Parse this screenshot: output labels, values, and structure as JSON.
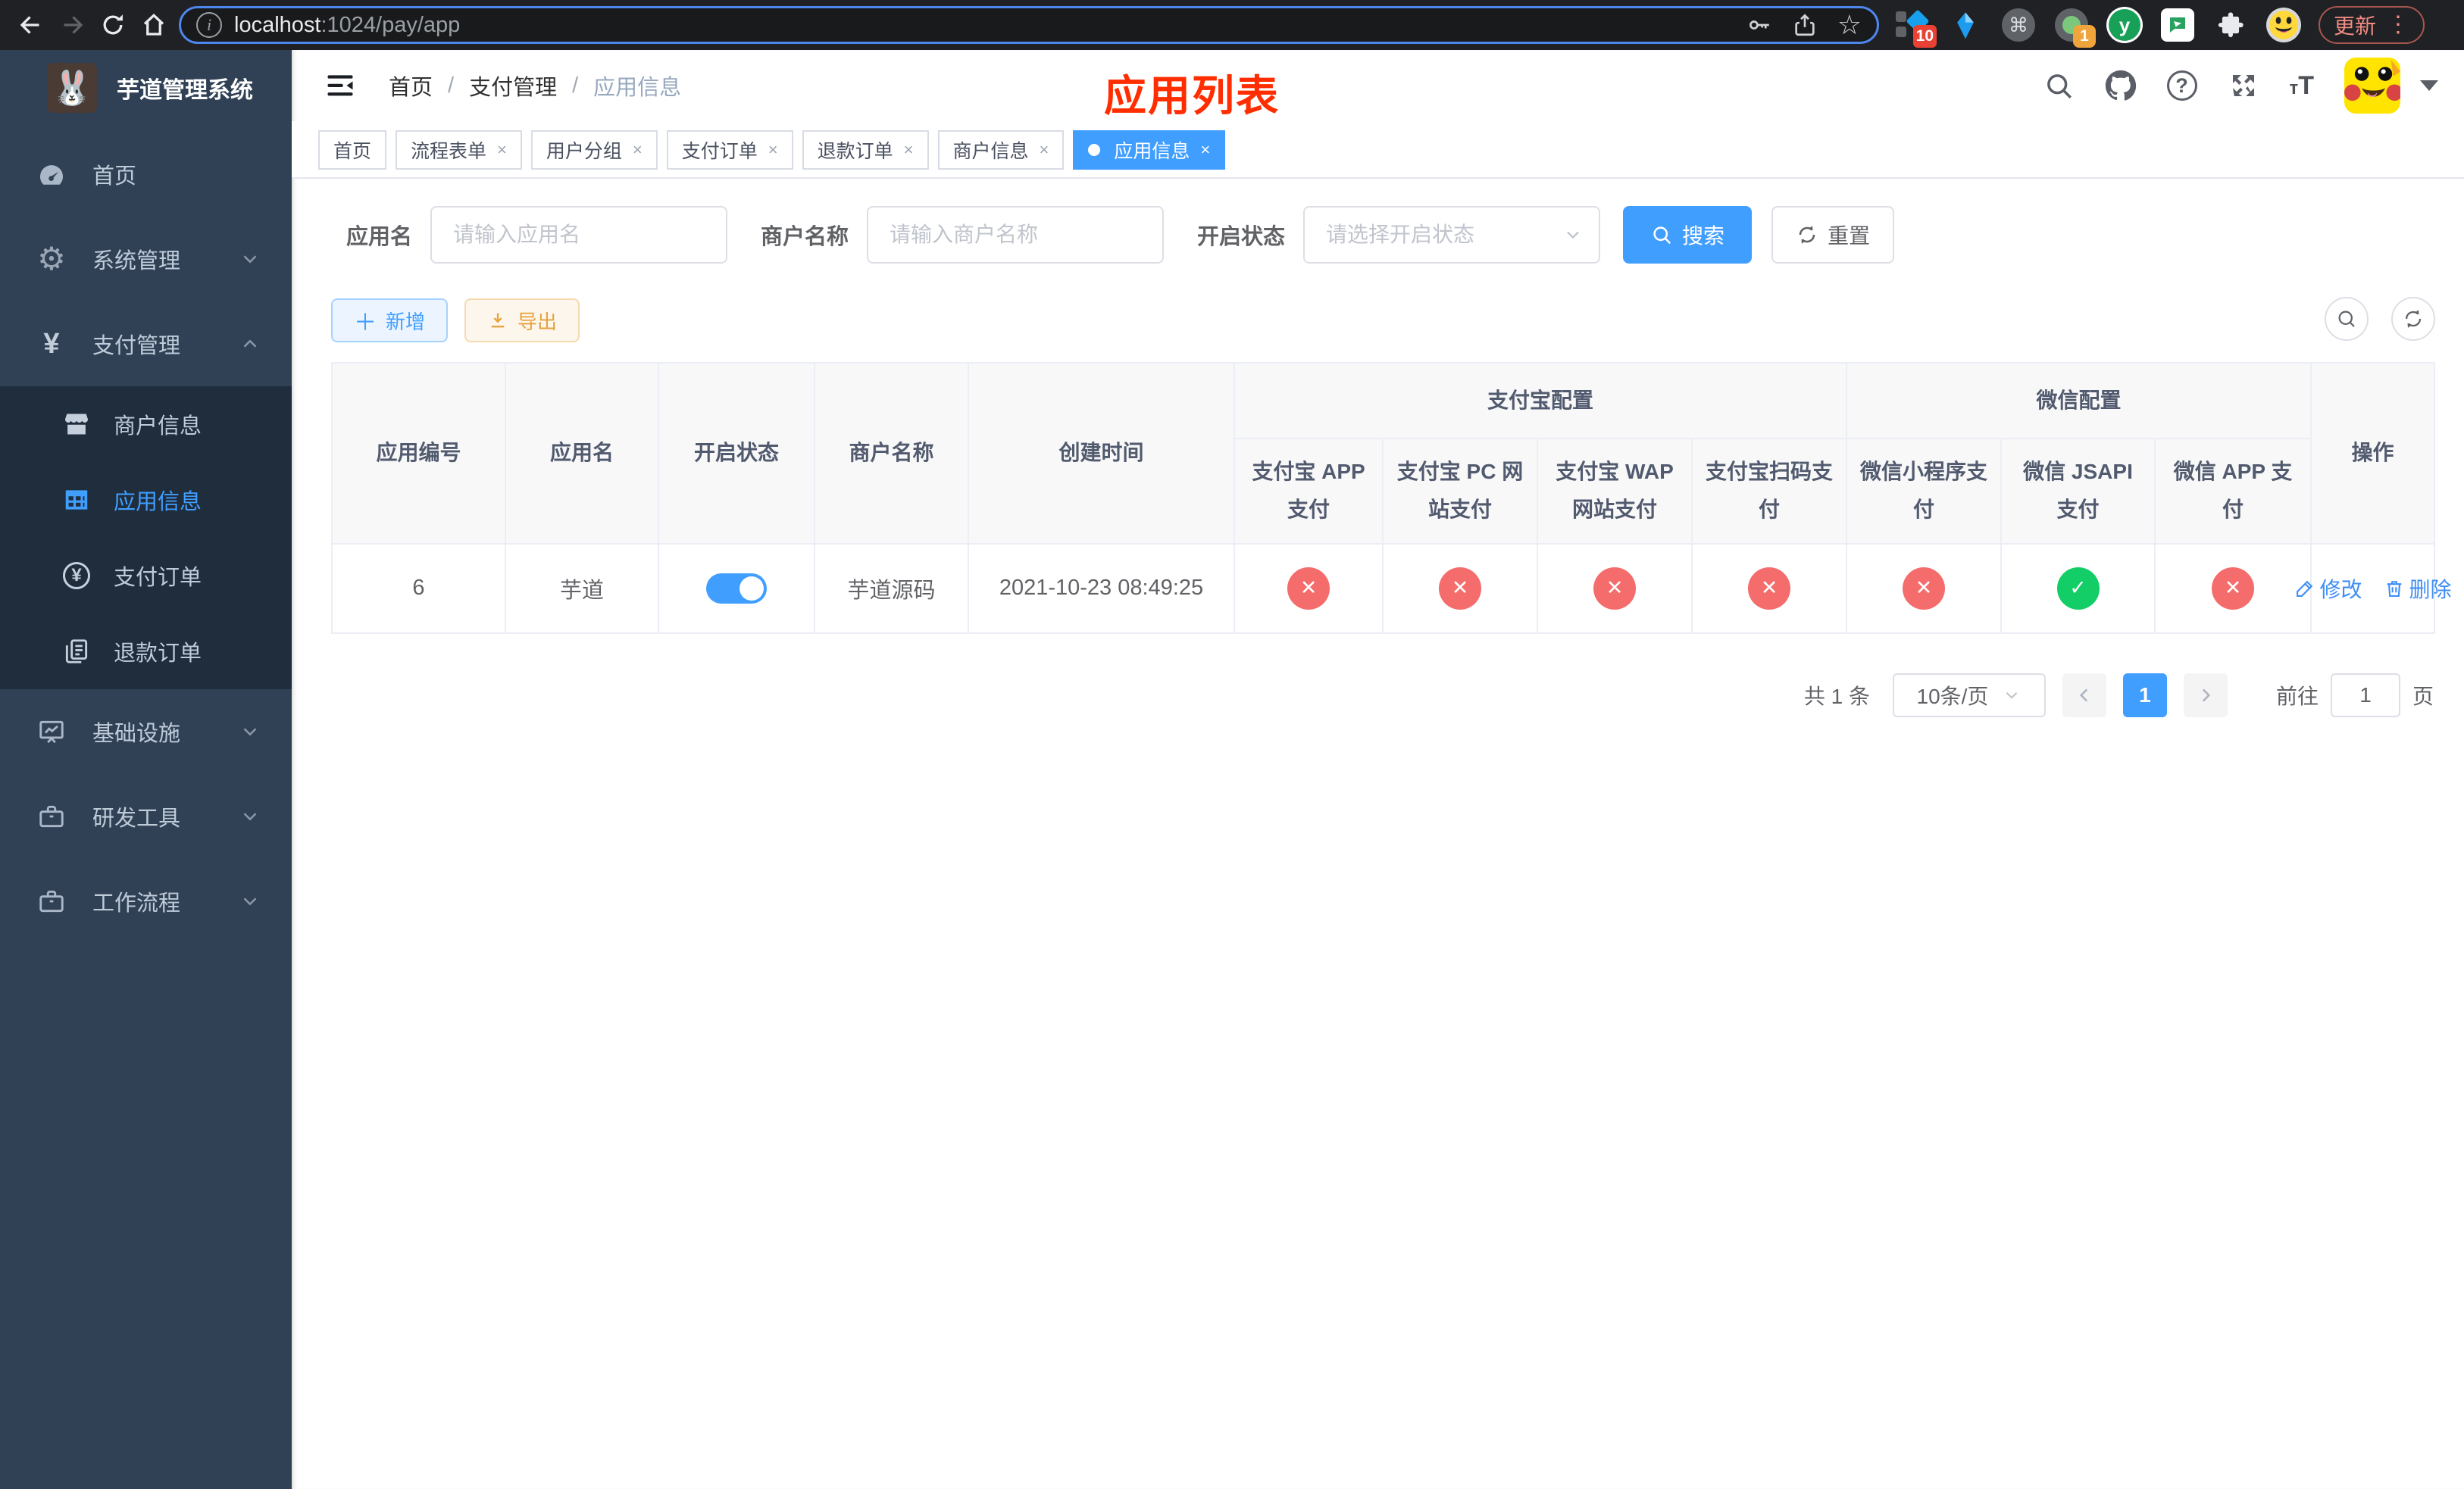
{
  "browser": {
    "url_host": "localhost",
    "url_rest": ":1024/pay/app",
    "update_label": "更新",
    "ext1_badge": "10",
    "ext4_badge": "1"
  },
  "sidebar": {
    "app_title": "芋道管理系统",
    "menu": [
      {
        "label": "首页"
      },
      {
        "label": "系统管理"
      },
      {
        "label": "支付管理"
      },
      {
        "label": "基础设施"
      },
      {
        "label": "研发工具"
      },
      {
        "label": "工作流程"
      }
    ],
    "submenu": [
      {
        "label": "商户信息"
      },
      {
        "label": "应用信息"
      },
      {
        "label": "支付订单"
      },
      {
        "label": "退款订单"
      }
    ]
  },
  "header": {
    "breadcrumb": [
      "首页",
      "支付管理",
      "应用信息"
    ],
    "page_title": "应用列表"
  },
  "tabs": [
    {
      "label": "首页"
    },
    {
      "label": "流程表单"
    },
    {
      "label": "用户分组"
    },
    {
      "label": "支付订单"
    },
    {
      "label": "退款订单"
    },
    {
      "label": "商户信息"
    },
    {
      "label": "应用信息"
    }
  ],
  "filters": {
    "app_name_label": "应用名",
    "app_name_placeholder": "请输入应用名",
    "merchant_label": "商户名称",
    "merchant_placeholder": "请输入商户名称",
    "status_label": "开启状态",
    "status_placeholder": "请选择开启状态",
    "search_label": "搜索",
    "reset_label": "重置"
  },
  "toolbar": {
    "add_label": "新增",
    "export_label": "导出"
  },
  "table": {
    "col_app_id": "应用编号",
    "col_app_name": "应用名",
    "col_status": "开启状态",
    "col_merchant": "商户名称",
    "col_created": "创建时间",
    "group_alipay": "支付宝配置",
    "group_wechat": "微信配置",
    "sub_cols": [
      "支付宝 APP 支付",
      "支付宝 PC 网站支付",
      "支付宝 WAP 网站支付",
      "支付宝扫码支付",
      "微信小程序支付",
      "微信 JSAPI 支付",
      "微信 APP 支付"
    ],
    "col_actions": "操作",
    "row": {
      "app_id": "6",
      "app_name": "芋道",
      "enabled": true,
      "merchant": "芋道源码",
      "created": "2021-10-23 08:49:25",
      "pay_statuses": [
        "no",
        "no",
        "no",
        "no",
        "no",
        "yes",
        "no"
      ]
    },
    "edit_label": "修改",
    "delete_label": "删除"
  },
  "pagination": {
    "total": "共 1 条",
    "page_size": "10条/页",
    "page": "1",
    "goto_label": "前往",
    "goto_value": "1",
    "unit_label": "页"
  }
}
